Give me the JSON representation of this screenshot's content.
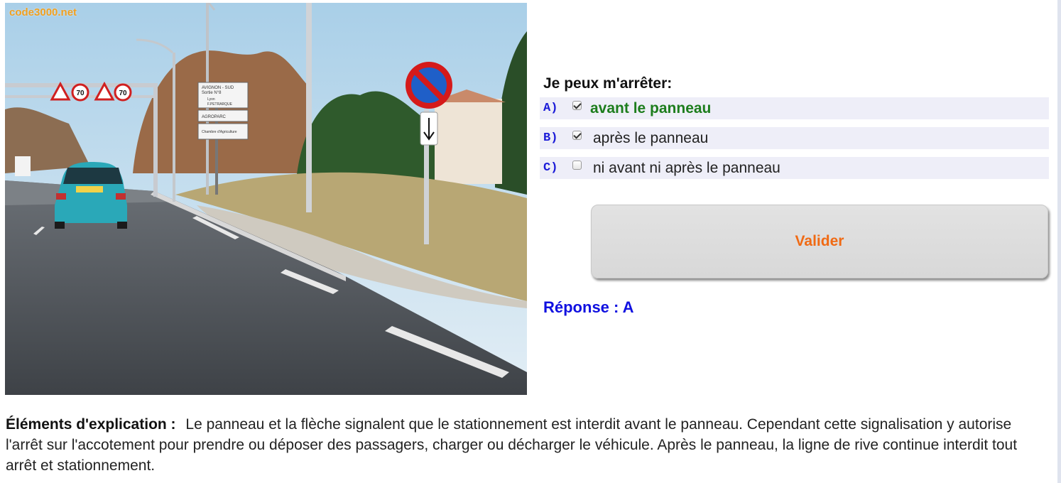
{
  "photo": {
    "watermark": "code3000.net",
    "speed_limit_1": "70",
    "speed_limit_2": "70",
    "direction_sign_lines": [
      "AVIGNON - SUD",
      "Sortie N°8",
      "Lyon",
      "F.PETRARQUE",
      "AGROPARC",
      "Chambre d'Agriculture"
    ]
  },
  "question": {
    "text": "Je peux m'arrêter:",
    "answers": [
      {
        "letter": "A)",
        "label": "avant le panneau",
        "checked": true,
        "correct": true
      },
      {
        "letter": "B)",
        "label": "après le panneau",
        "checked": true,
        "correct": false
      },
      {
        "letter": "C)",
        "label": "ni avant ni après le panneau",
        "checked": false,
        "correct": false
      }
    ]
  },
  "validate_label": "Valider",
  "reponse": "Réponse : A",
  "explication": {
    "title": "Éléments d'explication :",
    "text": "Le panneau et la flèche signalent que le stationnement est interdit avant le panneau. Cependant cette signalisation y autorise l'arrêt sur l'accotement pour prendre ou déposer des passagers, charger ou décharger le véhicule. Après le panneau, la ligne de rive continue interdit tout arrêt et stationnement."
  },
  "colors": {
    "question_letter": "#1a1ad8",
    "correct_answer": "#1d7d1d",
    "validate_text": "#f06a14",
    "reponse": "#1010e0"
  }
}
